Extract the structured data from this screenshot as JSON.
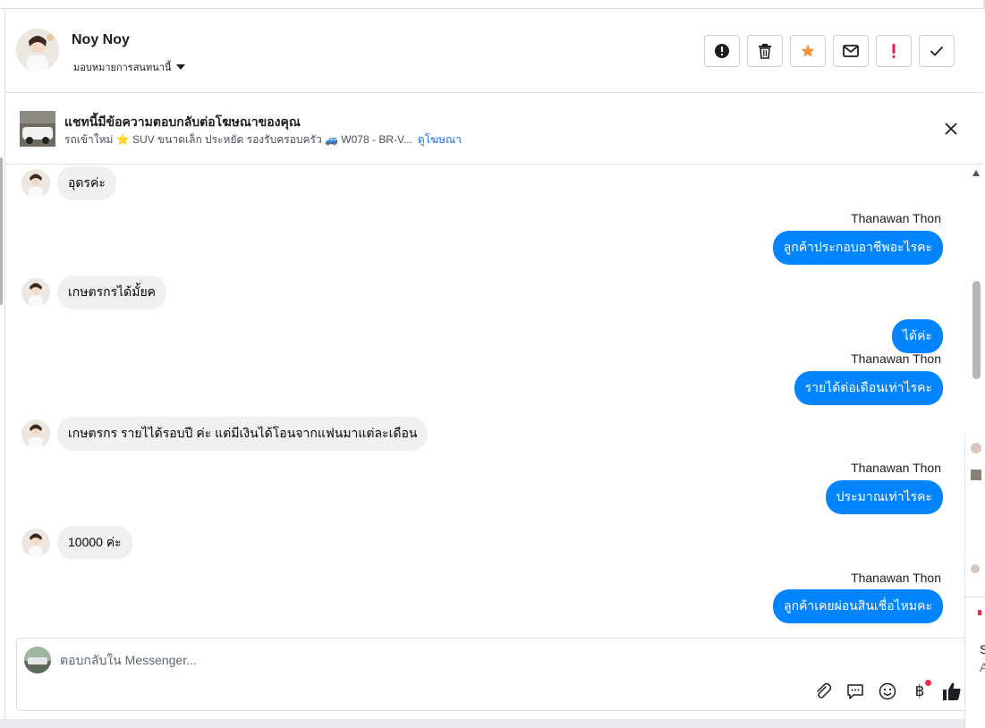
{
  "header": {
    "contact_name": "Noy Noy",
    "assign_label": "มอบหมายการสนทนานี้"
  },
  "header_actions": [
    {
      "icon": "alert-circle-icon"
    },
    {
      "icon": "trash-icon"
    },
    {
      "icon": "star-icon"
    },
    {
      "icon": "envelope-icon"
    },
    {
      "icon": "exclamation-icon"
    },
    {
      "icon": "check-icon"
    }
  ],
  "ad_banner": {
    "title": "แชทนี้มีข้อความตอบกลับต่อโฆษณาของคุณ",
    "subtitle": "รถเข้าใหม่ ⭐ SUV ขนาดเล็ก ประหยัด รองรับครอบครัว 🚙 W078 - BR-V...",
    "link": "ดูโฆษณา"
  },
  "messages": [
    {
      "direction": "in",
      "text": "อุดรค่ะ"
    },
    {
      "direction": "out",
      "sender": "Thanawan Thon",
      "text": "ลูกค้าประกอบอาชีพอะไรคะ"
    },
    {
      "direction": "in",
      "text": "เกษตรกรได้มั้ยค"
    },
    {
      "direction": "out",
      "text": "ได้ค่ะ"
    },
    {
      "direction": "out",
      "sender": "Thanawan Thon",
      "text": "รายได้ต่อเดือนเท่าไรคะ"
    },
    {
      "direction": "in",
      "text": "เกษตรกร รายไได้รอบปี ค่ะ แต่มีเงินได้โอนจากแฟนมาแต่ละเดือน"
    },
    {
      "direction": "out",
      "sender": "Thanawan Thon",
      "text": "ประมาณเท่าไรคะ"
    },
    {
      "direction": "in",
      "text": "10000 ค่ะ"
    },
    {
      "direction": "out",
      "sender": "Thanawan Thon",
      "text": "ลูกค้าเคยผ่อนสินเชื่อไหมคะ"
    }
  ],
  "composer": {
    "placeholder": "ตอบกลับใน Messenger...",
    "tools": [
      "paperclip-icon",
      "chat-bubble-icon",
      "emoji-icon",
      "baht-icon",
      "thumbs-up-icon"
    ],
    "baht_symbol": "฿"
  },
  "side_panel": {
    "text_1": "S",
    "text_2": "A"
  },
  "colors": {
    "outgoing_bubble": "#0084ff",
    "incoming_bubble": "#f0f0f0",
    "star": "#f7923b",
    "exclamation": "#e41e3f",
    "link": "#216fdb"
  }
}
